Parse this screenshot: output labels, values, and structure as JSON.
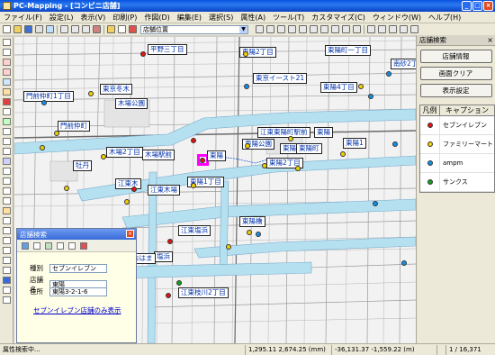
{
  "window": {
    "title": "PC-Mapping - [コンビニ店舗]"
  },
  "menu": [
    "ファイル(F)",
    "設定(L)",
    "表示(V)",
    "印刷(P)",
    "作図(D)",
    "編集(E)",
    "選択(S)",
    "属性(A)",
    "ツール(T)",
    "カスタマイズ(C)",
    "ウィンドウ(W)",
    "ヘルプ(H)"
  ],
  "toolbar": {
    "layer_combo": "店舗位置"
  },
  "map_places": [
    {
      "label": "平野三丁目"
    },
    {
      "label": "東京イースト21"
    },
    {
      "label": "東陽2丁目"
    },
    {
      "label": "東陽町一丁目"
    },
    {
      "label": "東陽4丁目"
    },
    {
      "label": "南砂2丁目"
    },
    {
      "label": "東京冬木"
    },
    {
      "label": "門前仲町1丁目"
    },
    {
      "label": "木場公園"
    },
    {
      "label": "門前仲町"
    },
    {
      "label": "江東東陽町駅前"
    },
    {
      "label": "東陽公園"
    },
    {
      "label": "東陽町駅前"
    },
    {
      "label": "東陽"
    },
    {
      "label": "木場2丁目"
    },
    {
      "label": "木場駅前"
    },
    {
      "label": "東陽2丁目"
    },
    {
      "label": "牡丹"
    },
    {
      "label": "東陽1丁目"
    },
    {
      "label": "江東木"
    },
    {
      "label": "江東木場"
    },
    {
      "label": "東陽町"
    },
    {
      "label": "東陽橋"
    },
    {
      "label": "江東塩浜"
    },
    {
      "label": "塩浜"
    },
    {
      "label": "おはま"
    },
    {
      "label": "江東枝川2丁目"
    },
    {
      "label": "東陽"
    },
    {
      "label": "東陽1"
    }
  ],
  "panel": {
    "title": "店舗検索",
    "buttons": [
      "店舗情報",
      "画面クリア",
      "表示設定"
    ],
    "legend": {
      "col1": "凡例",
      "col2": "キャプション",
      "items": [
        {
          "label": "セブンイレブン",
          "color": "#e81010"
        },
        {
          "label": "ファミリーマート",
          "color": "#f0d000"
        },
        {
          "label": "ampm",
          "color": "#1090e8"
        },
        {
          "label": "サンクス",
          "color": "#10a020"
        }
      ]
    }
  },
  "search_window": {
    "title": "店舗検索",
    "fields": [
      {
        "label": "種別",
        "value": "セブンイレブン"
      },
      {
        "label": "店舗名",
        "value": "東陽"
      },
      {
        "label": "住所",
        "value": "東陽3-2-1-6"
      }
    ],
    "link": "セブンイレブン店舗のみ表示"
  },
  "status": {
    "message": "属性検索中...",
    "coord1": "1,295.11  2,674.25  (mm)",
    "coord2": "-36,131.37  -1,559.22  (m)",
    "scale": "1 / 16,371"
  }
}
